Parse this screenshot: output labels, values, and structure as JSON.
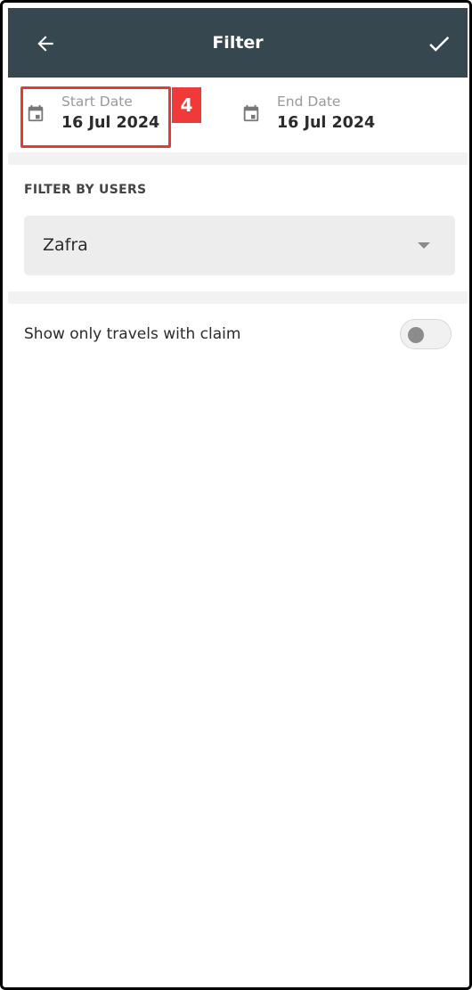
{
  "header": {
    "title": "Filter",
    "back_icon": "arrow-left-icon",
    "confirm_icon": "check-icon",
    "background_color": "#37474f"
  },
  "dates": {
    "start": {
      "label": "Start Date",
      "value": "16 Jul 2024",
      "icon": "calendar-icon"
    },
    "end": {
      "label": "End Date",
      "value": "16 Jul 2024",
      "icon": "calendar-icon"
    }
  },
  "annotation": {
    "badge": "4",
    "color": "#e53935"
  },
  "filter_users": {
    "section_label": "FILTER BY USERS",
    "selected": "Zafra",
    "dropdown_icon": "caret-down-icon"
  },
  "claim_toggle": {
    "label": "Show only travels with claim",
    "enabled": false
  }
}
